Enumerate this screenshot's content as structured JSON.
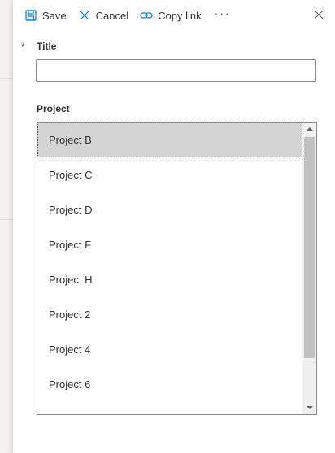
{
  "toolbar": {
    "save_label": "Save",
    "cancel_label": "Cancel",
    "copy_link_label": "Copy link",
    "more_label": "···",
    "icons": [
      "save-icon",
      "cancel-icon",
      "link-icon",
      "more-icon",
      "close-icon"
    ]
  },
  "form": {
    "required_marker": "*",
    "title_label": "Title",
    "title_value": "",
    "project_label": "Project",
    "project_options": [
      {
        "label": "Project B",
        "selected": true
      },
      {
        "label": "Project C",
        "selected": false
      },
      {
        "label": "Project D",
        "selected": false
      },
      {
        "label": "Project F",
        "selected": false
      },
      {
        "label": "Project H",
        "selected": false
      },
      {
        "label": "Project 2",
        "selected": false
      },
      {
        "label": "Project 4",
        "selected": false
      },
      {
        "label": "Project 6",
        "selected": false
      }
    ]
  },
  "colors": {
    "accent": "#0078d4",
    "selected_bg": "#d4d4d4",
    "border": "#8a8886",
    "text": "#323130"
  }
}
